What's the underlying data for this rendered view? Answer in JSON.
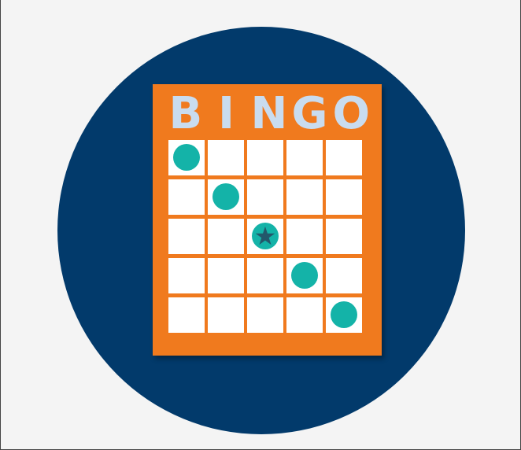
{
  "card": {
    "title_letters": [
      "B",
      "I",
      "N",
      "G",
      "O"
    ],
    "grid_rows": 5,
    "grid_cols": 5,
    "marked_cells": [
      [
        0,
        0
      ],
      [
        1,
        1
      ],
      [
        2,
        2
      ],
      [
        3,
        3
      ],
      [
        4,
        4
      ]
    ],
    "free_cell": [
      2,
      2
    ],
    "star_glyph": "★"
  },
  "colors": {
    "background": "#f4f4f4",
    "circle": "#023a6b",
    "card": "#f07a1e",
    "title_text": "#c9dcef",
    "cell": "#ffffff",
    "marker": "#14b3a8",
    "star": "#23586b"
  }
}
